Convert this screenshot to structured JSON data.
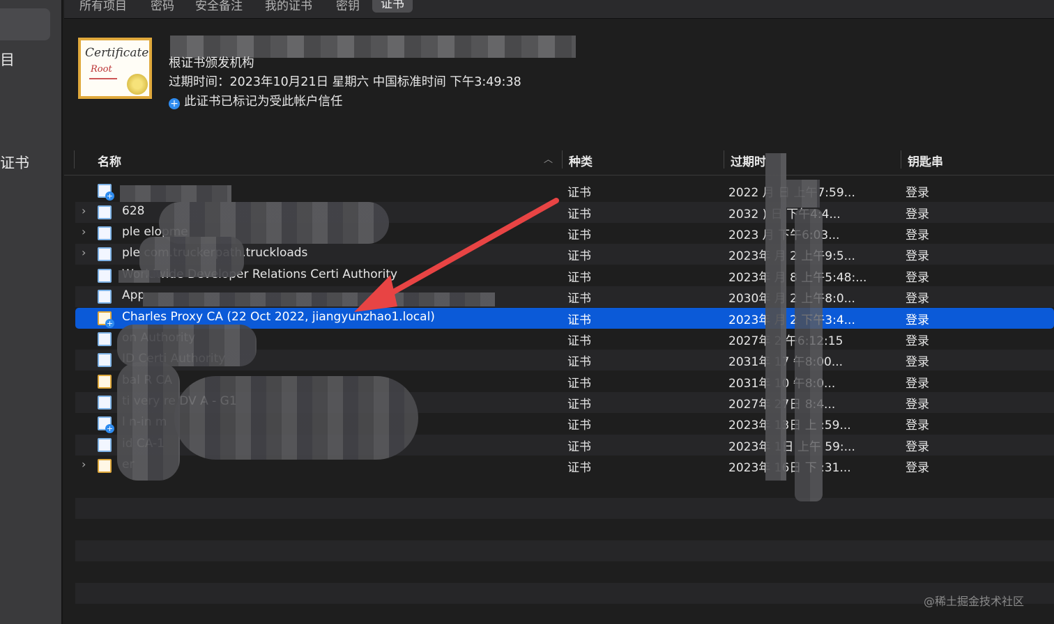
{
  "sidebar": {
    "items": [
      {
        "label": "目"
      },
      {
        "label": "证书"
      }
    ]
  },
  "tabs": [
    {
      "label": "所有项目"
    },
    {
      "label": "密码"
    },
    {
      "label": "安全备注"
    },
    {
      "label": "我的证书"
    },
    {
      "label": "密钥"
    },
    {
      "label": "证书"
    }
  ],
  "detail": {
    "cert_text_line1": "Certificate",
    "cert_text_line2": "Root",
    "subtitle": "根证书颁发机构",
    "expiry": "过期时间：2023年10月21日 星期六 中国标准时间 下午3:49:38",
    "trust_note": "此证书已标记为受此帐户信任"
  },
  "table": {
    "columns": {
      "name": "名称",
      "kind": "种类",
      "expires": "过期时",
      "keychain": "钥匙串"
    },
    "rows": [
      {
        "name": "",
        "kind": "证书",
        "expires": "2022    月     日 上午7:59...",
        "keychain": "登录"
      },
      {
        "name": "   628",
        "kind": "证书",
        "expires": "2032    )     日 下午4:4...",
        "keychain": "登录"
      },
      {
        "name": "   ple        elopme",
        "kind": "证书",
        "expires": "2023          月      下午6:03...",
        "keychain": "登录"
      },
      {
        "name": "   ple                      com.truckerpath.truckloads",
        "kind": "证书",
        "expires": "2023年      月 2     上午9:5...",
        "keychain": "登录"
      },
      {
        "name": "        Worldwide Developer Relations Certi          Authority",
        "kind": "证书",
        "expires": "2023年      月 8     上午5:48:...",
        "keychain": "登录"
      },
      {
        "name": "App",
        "kind": "证书",
        "expires": "2030年      月 2      上午8:0...",
        "keychain": "登录"
      },
      {
        "name": "Charles Proxy CA (22 Oct 2022, jiangyunzhao1.local)",
        "kind": "证书",
        "expires": "2023年      月 2      下午3:4...",
        "keychain": "登录"
      },
      {
        "name": "                         on Authority",
        "kind": "证书",
        "expires": "2027年      2       午6:12:15",
        "keychain": "登录"
      },
      {
        "name": "             ID Certi             Authority",
        "kind": "证书",
        "expires": "2031年      17      午8:00...",
        "keychain": "登录"
      },
      {
        "name": "             bal R        CA",
        "kind": "证书",
        "expires": "2031年      10      午8:0...",
        "keychain": "登录"
      },
      {
        "name": "          ti   very      re DV          A - G1",
        "kind": "证书",
        "expires": "2027年      27日       8:4...",
        "keychain": "登录"
      },
      {
        "name": "   l          n-in      m",
        "kind": "证书",
        "expires": "2023年      13日 上     :59...",
        "keychain": "登录"
      },
      {
        "name": "   id                               CA-1",
        "kind": "证书",
        "expires": "2023年      1日 上午     59:...",
        "keychain": "登录"
      },
      {
        "name": "              er",
        "kind": "证书",
        "expires": "2023年      16日 下      :31...",
        "keychain": "登录"
      }
    ]
  },
  "watermark": "@稀土掘金技术社区",
  "colors": {
    "selection": "#0b5ad8",
    "arrow": "#e84444",
    "trust_blue": "#2f8cf0"
  }
}
